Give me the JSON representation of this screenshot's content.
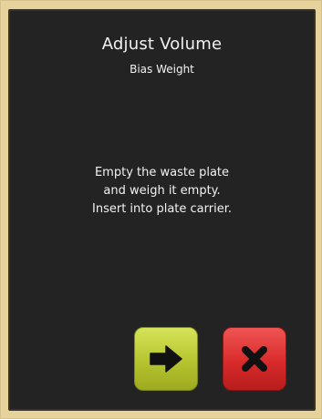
{
  "dialog": {
    "title": "Adjust Volume",
    "subtitle": "Bias Weight",
    "message_lines": [
      "Empty the waste plate",
      "and weigh it empty.",
      "Insert into plate carrier."
    ]
  },
  "buttons": {
    "next": {
      "icon": "arrow-right-icon",
      "color": "#c3d13a"
    },
    "cancel": {
      "icon": "x-close-icon",
      "color": "#e33a3a"
    }
  },
  "colors": {
    "bezel": "#e6d39c",
    "screen": "#232323",
    "text": "#f2f2f2"
  }
}
